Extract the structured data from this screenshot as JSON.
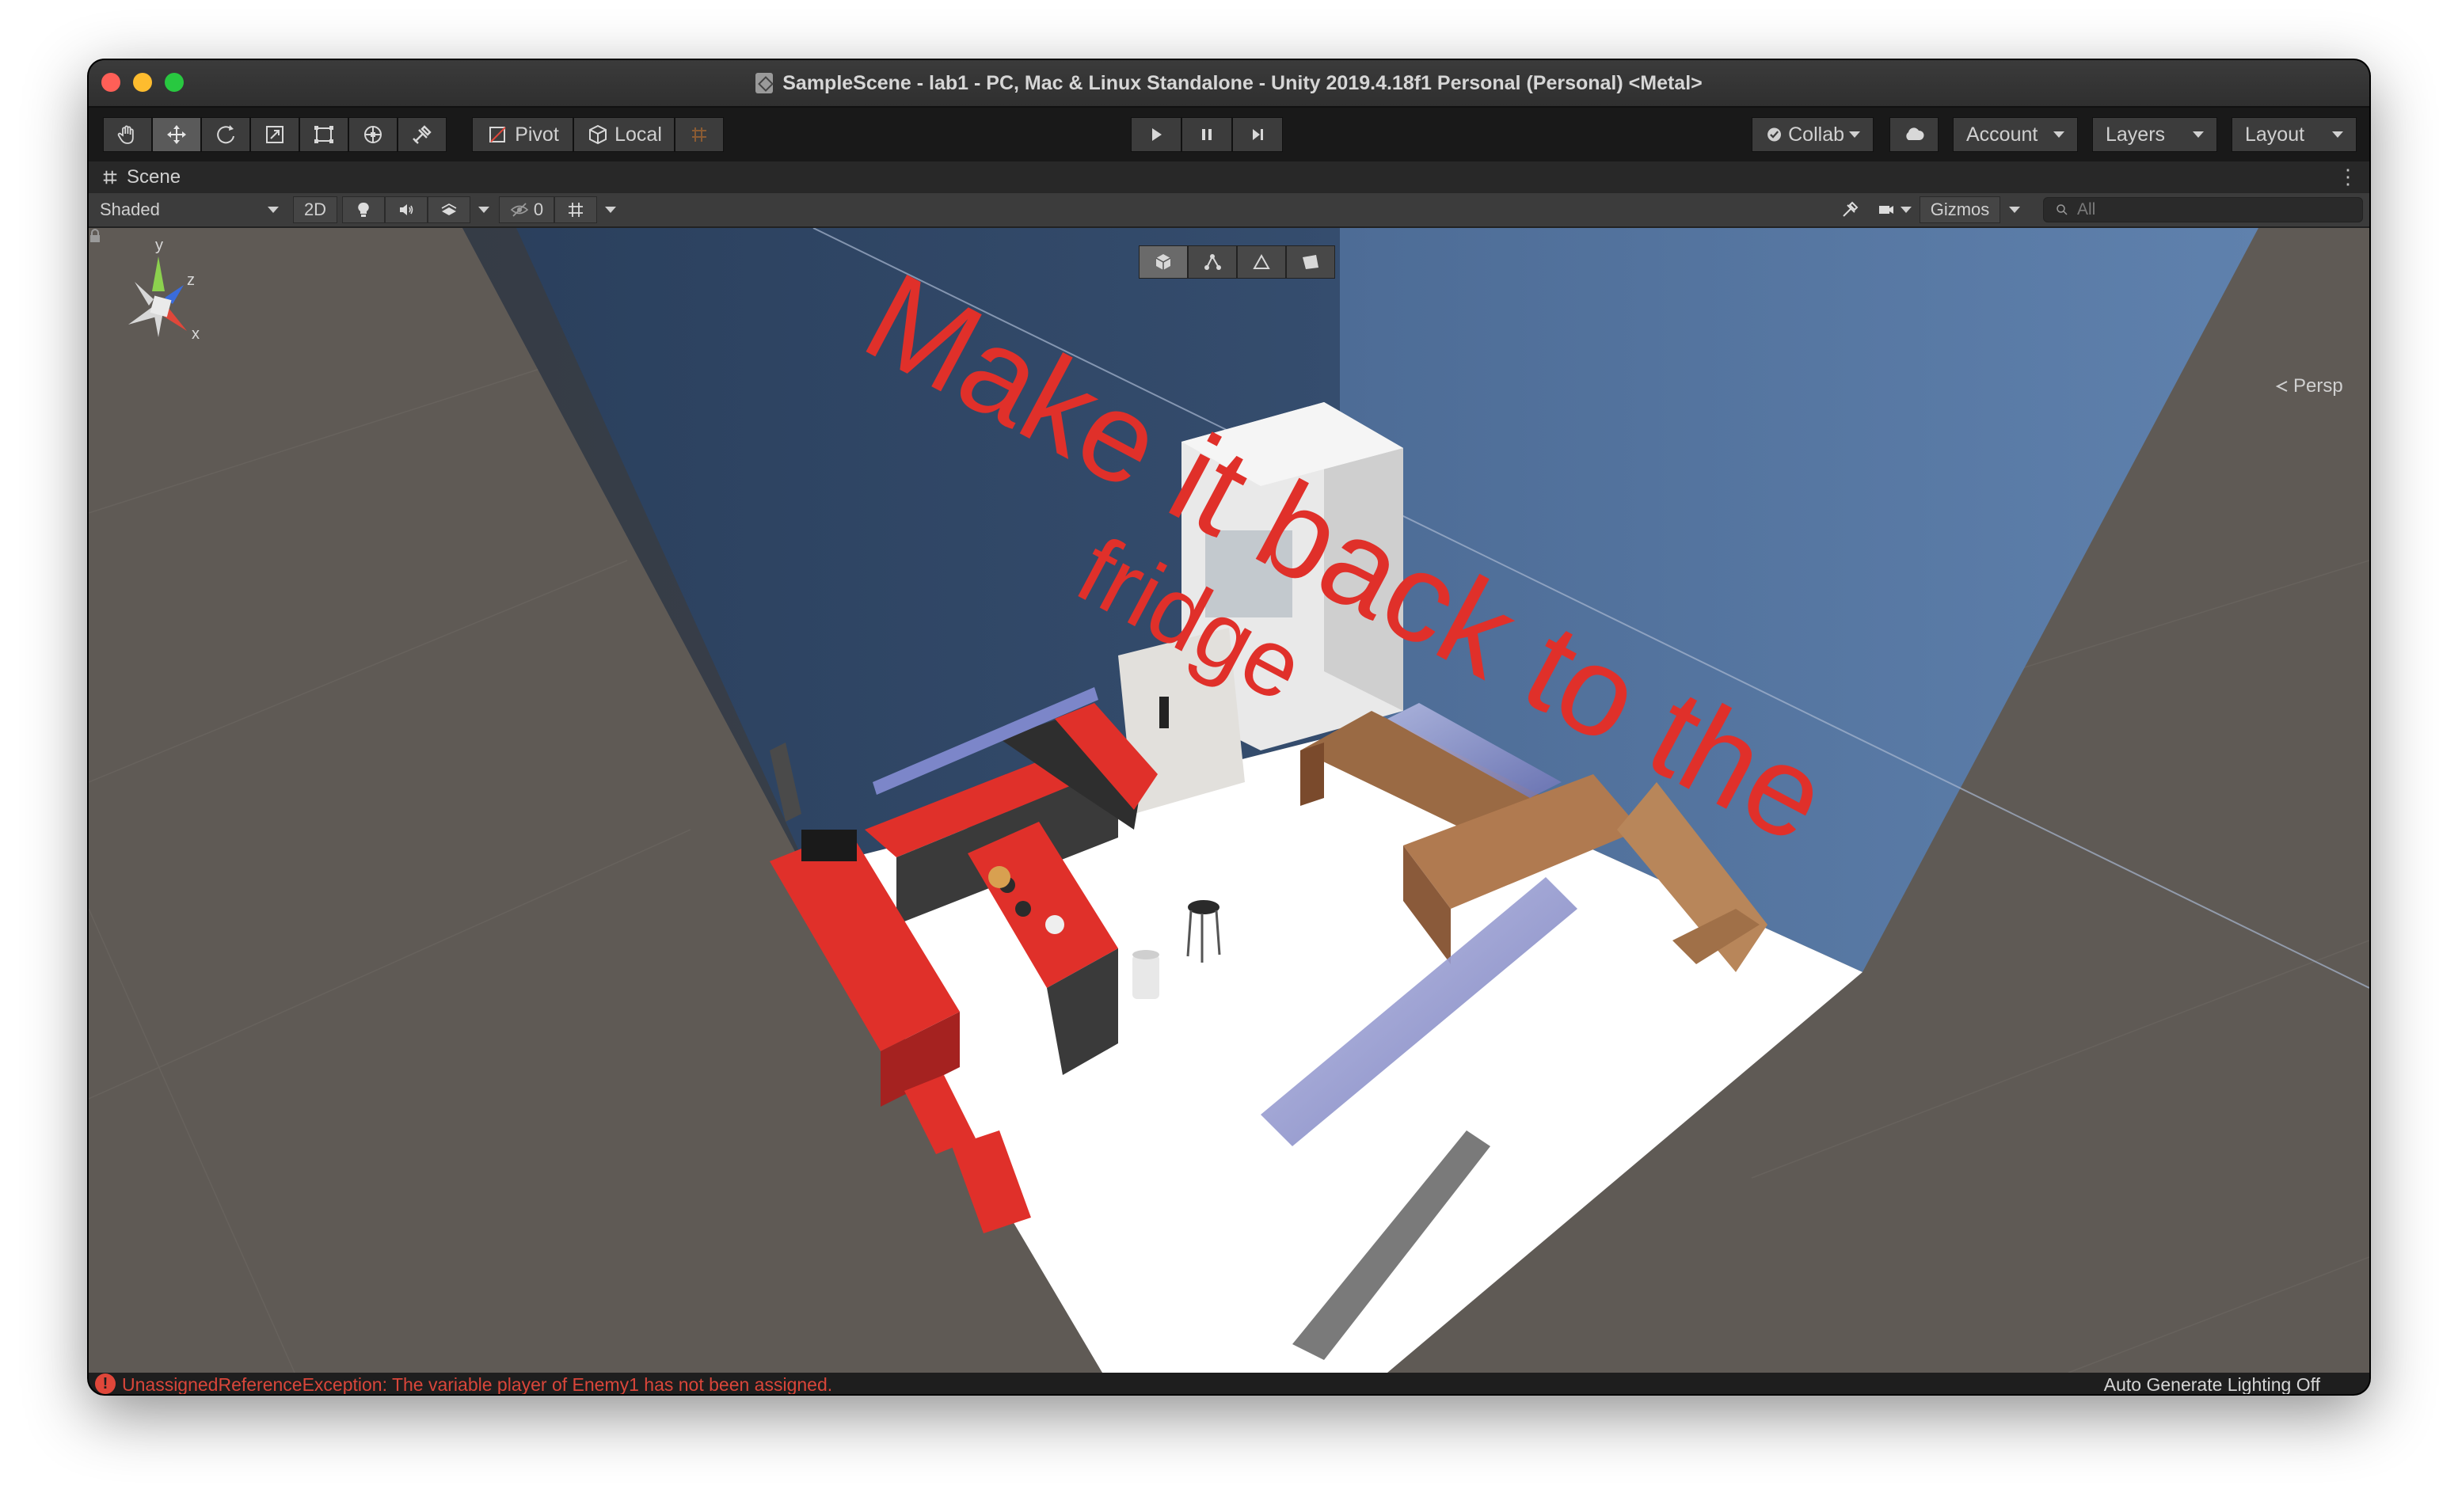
{
  "window": {
    "title": "SampleScene - lab1 - PC, Mac & Linux Standalone - Unity 2019.4.18f1 Personal (Personal) <Metal>"
  },
  "toolbar": {
    "transform_tools": [
      "hand-tool-icon",
      "move-tool-icon",
      "rotate-tool-icon",
      "scale-tool-icon",
      "rect-tool-icon",
      "transform-tool-icon",
      "custom-tool-icon"
    ],
    "pivot_label": "Pivot",
    "local_label": "Local",
    "playback": [
      "play-icon",
      "pause-icon",
      "step-icon"
    ],
    "collab_label": "Collab",
    "account_label": "Account",
    "layers_label": "Layers",
    "layout_label": "Layout"
  },
  "scene_tab": {
    "label": "Scene"
  },
  "scene_toolbar": {
    "shading_mode": "Shaded",
    "mode_2d_label": "2D",
    "hidden_count": "0",
    "gizmos_label": "Gizmos",
    "search_placeholder": "All"
  },
  "viewport": {
    "scene_text_line1": "Make it back to the",
    "scene_text_line2": "fridge",
    "scene_text_color": "#e0302a",
    "axis_labels": {
      "y": "y",
      "z": "z",
      "x": "x"
    },
    "projection_label": "Persp"
  },
  "status": {
    "error_icon_glyph": "!",
    "error_message": "UnassignedReferenceException: The variable player of Enemy1 has not been assigned.",
    "lighting": "Auto Generate Lighting Off"
  },
  "colors": {
    "error": "#d9463a",
    "wall_left": "#2f4563",
    "wall_right": "#56769f",
    "floor": "#ffffff",
    "kitchen_red": "#e0302a"
  }
}
